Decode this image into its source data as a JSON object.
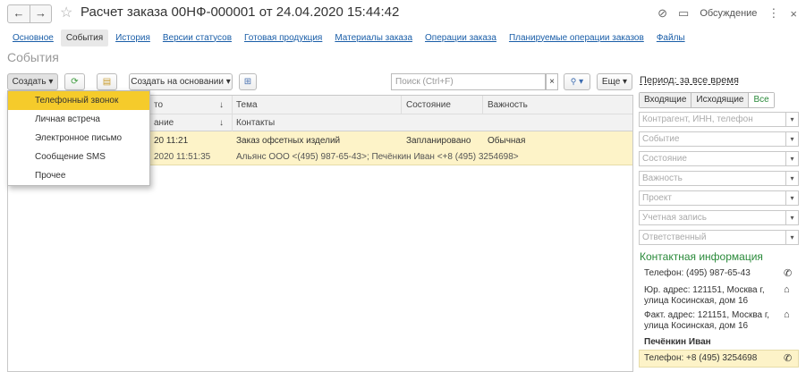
{
  "window": {
    "title": "Расчет заказа 00НФ-000001 от 24.04.2020 15:44:42",
    "back": "←",
    "forward": "→",
    "favorite": "☆",
    "link_icon": "⊘",
    "discuss_icon": "▭",
    "discuss_label": "Обсуждение",
    "more_icon": "⋮",
    "close_icon": "×"
  },
  "sections": [
    "Основное",
    "События",
    "История",
    "Версии статусов",
    "Готовая продукция",
    "Материалы заказа",
    "Операции заказа",
    "Планируемые операции заказов",
    "Файлы"
  ],
  "active_section": "События",
  "page_title": "События",
  "toolbar": {
    "create": "Создать",
    "create_arrow": "▾",
    "create_basis": "Создать на основании",
    "basis_arrow": "▾",
    "search_placeholder": "Поиск (Ctrl+F)",
    "clear_icon": "×",
    "find_icon": "🔍",
    "find_arrow": "▾",
    "more": "Еще",
    "more_arrow": "▾"
  },
  "create_menu": [
    "Телефонный звонок",
    "Личная встреча",
    "Электронное письмо",
    "Сообщение SMS",
    "Прочее"
  ],
  "table": {
    "headers": {
      "date": "то",
      "date_sort": "↓",
      "subject": "Тема",
      "state": "Состояние",
      "importance": "Важность",
      "responsible": "ание",
      "resp_sort": "↓",
      "contacts": "Контакты"
    },
    "rows": [
      {
        "date": "20 11:21",
        "subject": "Заказ офсетных изделий",
        "state": "Запланировано",
        "importance": "Обычная",
        "date2": "2020 11:51:35",
        "contacts": "Альянс ООО <(495) 987-65-43>; Печёнкин Иван <+8 (495) 3254698>"
      }
    ]
  },
  "right_panel": {
    "period": "Период: за все время",
    "segments": [
      "Входящие",
      "Исходящие",
      "Все"
    ],
    "active_segment": "Все",
    "filters": [
      "Контрагент, ИНН, телефон",
      "Событие",
      "Состояние",
      "Важность",
      "Проект",
      "Учетная запись",
      "Ответственный"
    ],
    "dd_arrow": "▾",
    "contact_info_title": "Контактная информация",
    "phone1": "Телефон: (495) 987-65-43",
    "legal_address_1": "Юр. адрес: 121151, Москва г,",
    "legal_address_2": "улица Косинская, дом 16",
    "actual_address_1": "Факт. адрес: 121151, Москва г,",
    "actual_address_2": "улица Косинская, дом 16",
    "person": "Печёнкин Иван",
    "phone2": "Телефон: +8 (495) 3254698",
    "phone_icon": "✆",
    "home_icon": "⌂"
  },
  "colors": {
    "link": "#1a5ea8",
    "highlight": "#f5cb2b",
    "row_bg": "#fdf3c8",
    "accent_green": "#2a8a3a"
  }
}
